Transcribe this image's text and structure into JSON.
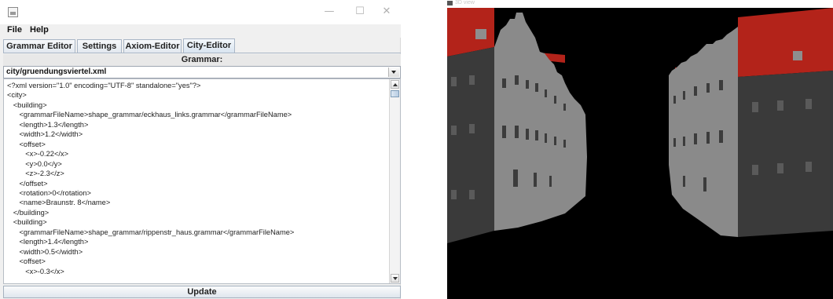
{
  "editor_window": {
    "window_controls": {
      "minimize": "—",
      "maximize": "☐",
      "close": "✕"
    },
    "menu": [
      "File",
      "Help"
    ],
    "tabs": [
      {
        "label": "Grammar Editor",
        "active": false
      },
      {
        "label": "Settings",
        "active": false
      },
      {
        "label": "Axiom-Editor",
        "active": false
      },
      {
        "label": "City-Editor",
        "active": true
      }
    ],
    "section_label": "Grammar:",
    "file_select": {
      "value": "city/gruendungsviertel.xml"
    },
    "code_lines": [
      "<?xml version=\"1.0\" encoding=\"UTF-8\" standalone=\"yes\"?>",
      "<city>",
      "   <building>",
      "      <grammarFileName>shape_grammar/eckhaus_links.grammar</grammarFileName>",
      "      <length>1.3</length>",
      "      <width>1.2</width>",
      "      <offset>",
      "         <x>-0.22</x>",
      "         <y>0.0</y>",
      "         <z>-2.3</z>",
      "      </offset>",
      "      <rotation>0</rotation>",
      "      <name>Braunstr. 8</name>",
      "   </building>",
      "   <building>",
      "      <grammarFileName>shape_grammar/rippenstr_haus.grammar</grammarFileName>",
      "      <length>1.4</length>",
      "      <width>0.5</width>",
      "      <offset>",
      "         <x>-0.3</x>"
    ],
    "update_button": "Update",
    "icons": {
      "app": "java-app-icon",
      "combo_arrow": "chevron-down-icon",
      "scroll_up": "arrow-up-icon",
      "scroll_down": "arrow-down-icon"
    }
  },
  "viewer_window": {
    "title": "3D view",
    "colors": {
      "sky": "#000000",
      "roof": "#b3231a",
      "facade_lit": "#8c8c8c",
      "facade_shadow": "#3e3e3e",
      "ground": "#000000"
    }
  }
}
